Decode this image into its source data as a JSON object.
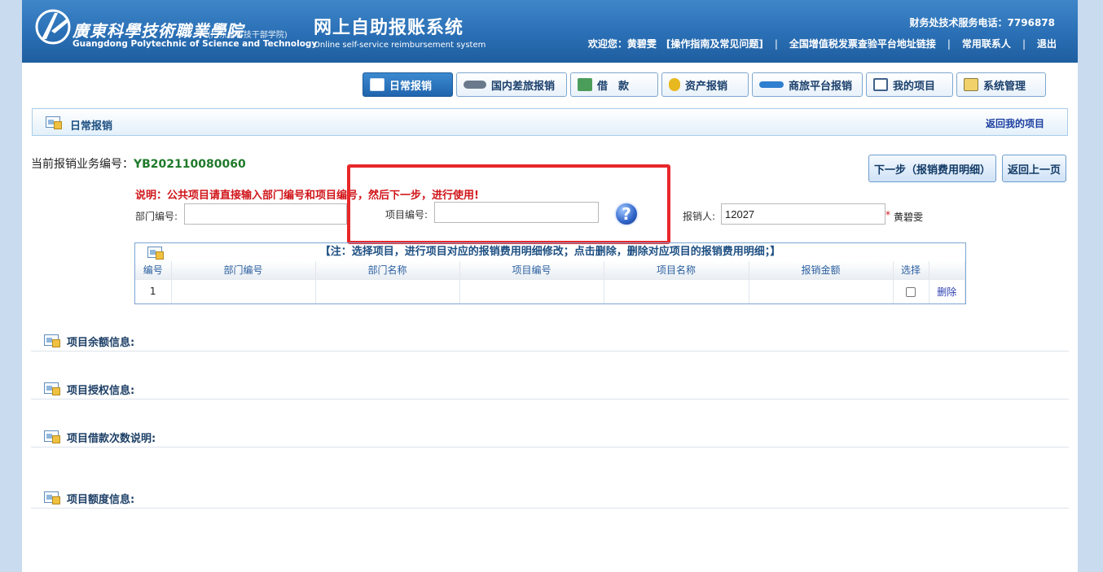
{
  "header": {
    "logo_cn": "廣東科學技術職業學院",
    "logo_cn_sub": "(广东省科技干部学院)",
    "logo_en": "Guangdong Polytechnic of Science and Technology",
    "system_title": "网上自助报账系统",
    "system_subtitle": "Online self-service reimbursement system",
    "hotline": "财务处技术服务电话：7796878",
    "welcome": "欢迎您：黄碧雯",
    "nav": [
      "[操作指南及常见问题]",
      "全国增值税发票查验平台地址链接",
      "常用联系人",
      "退出"
    ]
  },
  "tabs": [
    {
      "label": "日常报销",
      "icon": "list-icon",
      "active": true
    },
    {
      "label": "国内差旅报销",
      "icon": "train-icon",
      "active": false
    },
    {
      "label": "借　款",
      "icon": "loan-icon",
      "active": false
    },
    {
      "label": "资产报销",
      "icon": "coins-icon",
      "active": false
    },
    {
      "label": "商旅平台报销",
      "icon": "plane-icon",
      "active": false
    },
    {
      "label": "我的项目",
      "icon": "project-list-icon",
      "active": false
    },
    {
      "label": "系统管理",
      "icon": "settings-doc-icon",
      "active": false
    }
  ],
  "section": {
    "title": "日常报销",
    "back_link": "返回我的项目"
  },
  "business": {
    "label": "当前报销业务编号：",
    "number": "YB202110080060"
  },
  "buttons": {
    "next": "下一步（报销费用明细）",
    "back": "返回上一页"
  },
  "form": {
    "note": "说明：公共项目请直接输入部门编号和项目编号，然后下一步，进行使用!",
    "dept_label": "部门编号:",
    "dept_value": "",
    "project_label": "项目编号:",
    "project_value": "",
    "reporter_label": "报销人:",
    "reporter_value": "12027",
    "reporter_required": "*",
    "reporter_name": "黄碧雯",
    "help": "?"
  },
  "table": {
    "note": "【注：选择项目，进行项目对应的报销费用明细修改；点击删除，删除对应项目的报销费用明细；】",
    "columns": [
      "编号",
      "部门编号",
      "部门名称",
      "项目编号",
      "项目名称",
      "报销金额",
      "选择",
      ""
    ],
    "rows": [
      {
        "no": "1",
        "dept_no": "",
        "dept_name": "",
        "project_no": "",
        "project_name": "",
        "amount": "",
        "selected": false,
        "action": "删除"
      }
    ]
  },
  "info_sections": [
    "项目余额信息:",
    "项目授权信息:",
    "项目借款次数说明:",
    "项目额度信息:"
  ],
  "colors": {
    "header_blue": "#2a6fb5",
    "highlight_red": "#e8272a",
    "note_red": "#d0151a",
    "bizno_green": "#1f7a2a"
  }
}
